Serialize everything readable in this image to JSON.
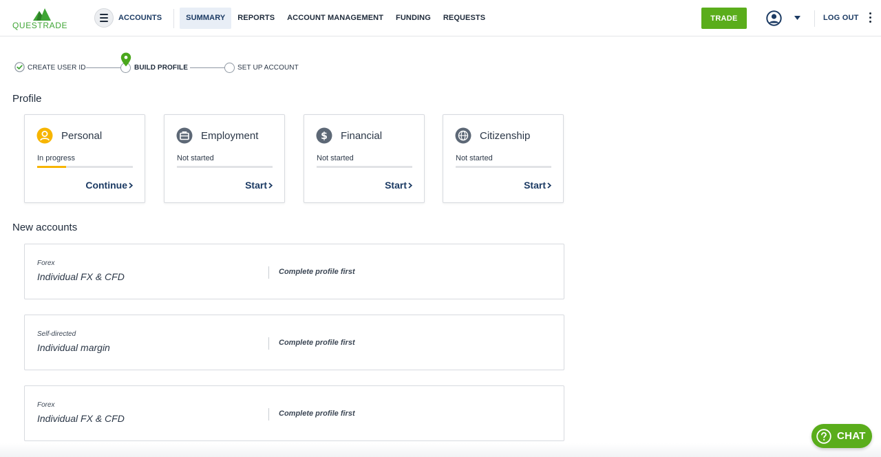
{
  "header": {
    "logo_text": "QUESTRADE",
    "menu_icon": "hamburger-icon",
    "nav": [
      {
        "label": "ACCOUNTS",
        "active": false
      },
      {
        "label": "SUMMARY",
        "active": true
      },
      {
        "label": "REPORTS",
        "active": false
      },
      {
        "label": "ACCOUNT MANAGEMENT",
        "active": false
      },
      {
        "label": "FUNDING",
        "active": false
      },
      {
        "label": "REQUESTS",
        "active": false
      }
    ],
    "trade_label": "TRADE",
    "user_icon": "user-circle-icon",
    "logout_label": "LOG OUT",
    "more_icon": "kebab-icon"
  },
  "stepper": {
    "steps": [
      {
        "label": "CREATE USER ID",
        "state": "complete"
      },
      {
        "label": "BUILD PROFILE",
        "state": "current"
      },
      {
        "label": "SET UP ACCOUNT",
        "state": "pending"
      }
    ]
  },
  "profile": {
    "title": "Profile",
    "cards": [
      {
        "title": "Personal",
        "status": "In progress",
        "progress": 0.3,
        "action": "Continue",
        "icon": "person-icon",
        "icon_color": "#f7b500"
      },
      {
        "title": "Employment",
        "status": "Not started",
        "progress": 0,
        "action": "Start",
        "icon": "briefcase-icon",
        "icon_color": "#5d6876"
      },
      {
        "title": "Financial",
        "status": "Not started",
        "progress": 0,
        "action": "Start",
        "icon": "dollar-icon",
        "icon_color": "#5d6876"
      },
      {
        "title": "Citizenship",
        "status": "Not started",
        "progress": 0,
        "action": "Start",
        "icon": "globe-icon",
        "icon_color": "#5d6876"
      }
    ]
  },
  "new_accounts": {
    "title": "New accounts",
    "items": [
      {
        "type": "Forex",
        "name": "Individual FX & CFD",
        "note": "Complete profile first"
      },
      {
        "type": "Self-directed",
        "name": "Individual margin",
        "note": "Complete profile first"
      },
      {
        "type": "Forex",
        "name": "Individual FX & CFD",
        "note": "Complete profile first"
      }
    ]
  },
  "chat": {
    "label": "CHAT",
    "icon": "question-circle-icon"
  },
  "colors": {
    "brand_green": "#5aad1b",
    "navy": "#1b3a63",
    "progress_yellow": "#f7b500"
  }
}
